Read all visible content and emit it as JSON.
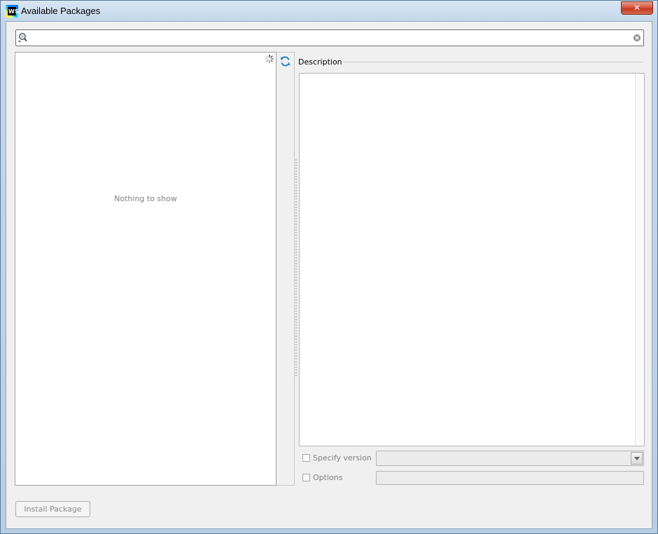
{
  "window": {
    "title": "Available Packages",
    "close_label": "✕"
  },
  "search": {
    "value": "",
    "placeholder": ""
  },
  "package_list": {
    "empty_text": "Nothing to show"
  },
  "description": {
    "label": "Description",
    "text": ""
  },
  "version": {
    "checkbox_label": "Specify version",
    "checked": false,
    "selected": ""
  },
  "options": {
    "checkbox_label": "Options",
    "checked": false,
    "value": ""
  },
  "footer": {
    "install_label": "Install Package"
  },
  "icons": {
    "app": "webstorm-icon",
    "search": "search-icon",
    "clear": "clear-search-icon",
    "spinner": "loading-spinner-icon",
    "refresh": "refresh-icon"
  },
  "colors": {
    "accent_blue": "#2a7fc0",
    "disabled_text": "#808080"
  }
}
